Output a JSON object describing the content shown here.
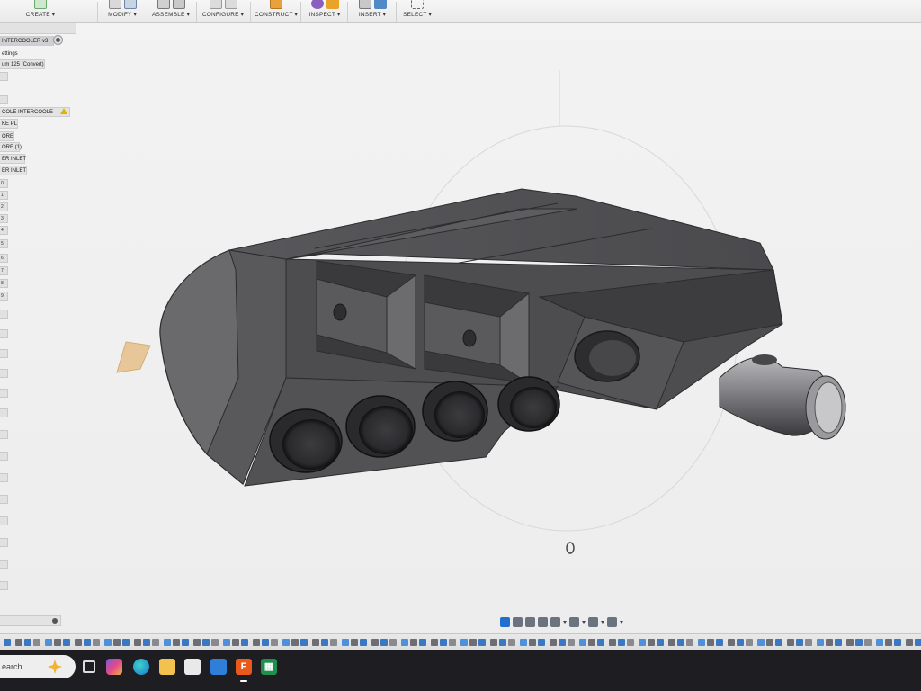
{
  "toolbar": {
    "groups": [
      {
        "label": "CREATE ▾"
      },
      {
        "label": "MODIFY ▾"
      },
      {
        "label": "ASSEMBLE ▾"
      },
      {
        "label": "CONFIGURE ▾"
      },
      {
        "label": "CONSTRUCT ▾"
      },
      {
        "label": "INSPECT ▾"
      },
      {
        "label": "INSERT ▾"
      },
      {
        "label": "SELECT ▾"
      }
    ]
  },
  "browser": {
    "document_name": "INTERCOOLER v3",
    "rows": [
      {
        "label": "ettings"
      },
      {
        "label": "um 125 (Convert)"
      },
      {
        "label": "COLE INTERCOOLE"
      },
      {
        "label": "KE PL"
      },
      {
        "label": "ORE"
      },
      {
        "label": "ORE (1)"
      },
      {
        "label": "ER INLET"
      },
      {
        "label": "ER INLET"
      }
    ],
    "stubs": [
      "0",
      "1",
      "2",
      "3",
      "4",
      "5",
      "6",
      "7",
      "8",
      "9"
    ]
  },
  "viewcube": {
    "label": "⊗"
  },
  "taskbar": {
    "search_placeholder": "earch",
    "app_letters": {
      "fusion": "F",
      "sheets": "▦"
    }
  },
  "colors": {
    "accent": "#1f6fd1",
    "fusion_orange": "#e8591a",
    "warning": "#e2b400",
    "model_grey": "#4b4b4e"
  }
}
